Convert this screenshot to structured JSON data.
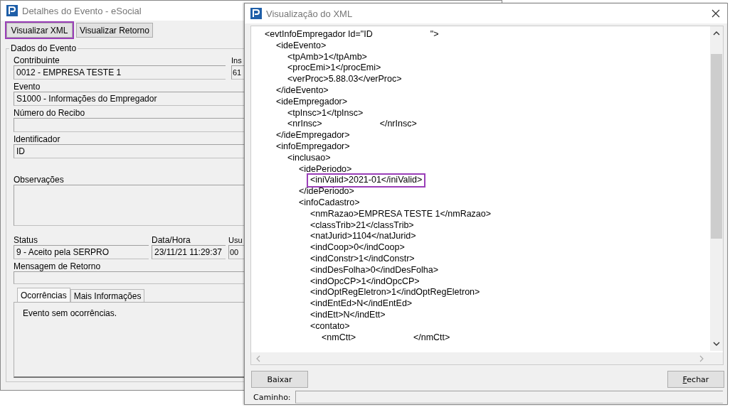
{
  "main_window": {
    "title": "Detalhes do Evento - eSocial",
    "buttons": [
      {
        "label": "Visualizar XML",
        "highlighted": true
      },
      {
        "label": "Visualizar Retorno",
        "highlighted": false
      }
    ],
    "group_title": "Dados do Evento",
    "contribuinte": {
      "label": "Contribuinte",
      "value": "0012 - EMPRESA TESTE 1"
    },
    "inscricao": {
      "label": "Ins",
      "value": "61"
    },
    "evento": {
      "label": "Evento",
      "value": "S1000 - Informações do Empregador"
    },
    "recibo": {
      "label": "Número do Recibo"
    },
    "identificador": {
      "label": "Identificador",
      "value": "ID"
    },
    "observacoes": {
      "label": "Observações"
    },
    "status": {
      "label": "Status",
      "value": "9 - Aceito pela SERPRO"
    },
    "data_hora": {
      "label": "Data/Hora",
      "value": "23/11/21 11:29:37"
    },
    "usuario": {
      "label": "Usu",
      "value": "00"
    },
    "mensagem": {
      "label": "Mensagem de Retorno"
    },
    "tabs": [
      {
        "label": "Ocorrências",
        "selected": true
      },
      {
        "label": "Mais Informações",
        "selected": false
      }
    ],
    "tab_content": "Evento sem ocorrências."
  },
  "xml_window": {
    "title": "Visualização do XML",
    "xml": [
      {
        "text": "<evtInfoEmpregador Id=\"ID",
        "tail": "\">",
        "children": [
          {
            "text": "<ideEvento>",
            "children": [
              {
                "text": "<tpAmb>1</tpAmb>"
              },
              {
                "text": "<procEmi>1</procEmi>"
              },
              {
                "text": "<verProc>5.88.03</verProc>"
              }
            ]
          },
          {
            "text": "</ideEvento>"
          },
          {
            "text": "<ideEmpregador>",
            "children": [
              {
                "text": "<tpInsc>1</tpInsc>"
              },
              {
                "text": "<nrInsc>",
                "tail": "</nrInsc>"
              }
            ]
          },
          {
            "text": "</ideEmpregador>"
          },
          {
            "text": "<infoEmpregador>",
            "children": [
              {
                "text": "<inclusao>",
                "children": [
                  {
                    "text": "<idePeriodo>",
                    "children": [
                      {
                        "text": "<iniValid>2021-01</iniValid>",
                        "highlighted": true
                      }
                    ]
                  },
                  {
                    "text": "</idePeriodo>"
                  },
                  {
                    "text": "<infoCadastro>",
                    "children": [
                      {
                        "text": "<nmRazao>EMPRESA TESTE 1</nmRazao>"
                      },
                      {
                        "text": "<classTrib>21</classTrib>"
                      },
                      {
                        "text": "<natJurid>1104</natJurid>"
                      },
                      {
                        "text": "<indCoop>0</indCoop>"
                      },
                      {
                        "text": "<indConstr>1</indConstr>"
                      },
                      {
                        "text": "<indDesFolha>0</indDesFolha>"
                      },
                      {
                        "text": "<indOpcCP>1</indOpcCP>"
                      },
                      {
                        "text": "<indOptRegEletron>1</indOptRegEletron>"
                      },
                      {
                        "text": "<indEntEd>N</indEntEd>"
                      },
                      {
                        "text": "<indEtt>N</indEtt>"
                      },
                      {
                        "text": "<contato>",
                        "children": [
                          {
                            "text": "<nmCtt>",
                            "tail": "</nmCtt>"
                          }
                        ]
                      }
                    ]
                  }
                ]
              }
            ]
          }
        ]
      }
    ],
    "buttons": [
      {
        "label": "Baixar"
      },
      {
        "label": "Fechar"
      }
    ],
    "path": {
      "label": "Caminho:"
    }
  }
}
